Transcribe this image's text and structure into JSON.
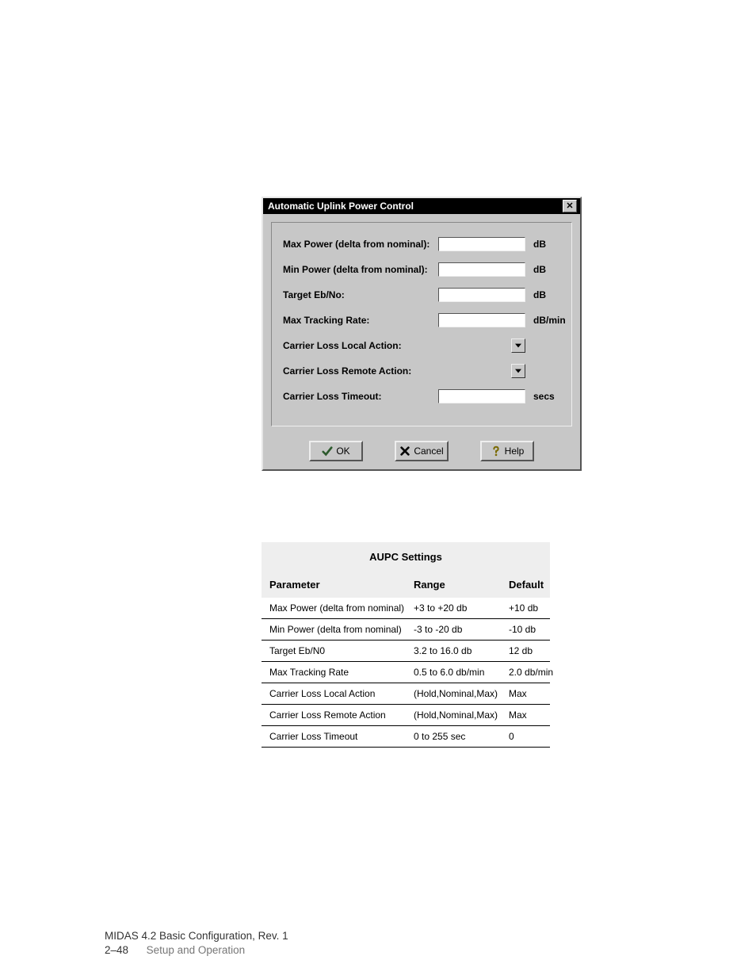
{
  "dialog": {
    "title": "Automatic Uplink Power Control",
    "close_glyph": "✕",
    "fields": [
      {
        "label": "Max Power (delta from nominal):",
        "type": "text",
        "unit": "dB"
      },
      {
        "label": "Min Power (delta from nominal):",
        "type": "text",
        "unit": "dB"
      },
      {
        "label": "Target Eb/No:",
        "type": "text",
        "unit": "dB"
      },
      {
        "label": "Max Tracking Rate:",
        "type": "text",
        "unit": "dB/min"
      },
      {
        "label": "Carrier Loss Local Action:",
        "type": "select",
        "unit": ""
      },
      {
        "label": "Carrier Loss Remote Action:",
        "type": "select",
        "unit": ""
      },
      {
        "label": "Carrier Loss Timeout:",
        "type": "text",
        "unit": "secs"
      }
    ],
    "buttons": {
      "ok": "OK",
      "cancel": "Cancel",
      "help": "Help"
    }
  },
  "table": {
    "title": "AUPC Settings",
    "headers": {
      "param": "Parameter",
      "range": "Range",
      "default": "Default"
    },
    "rows": [
      {
        "param": "Max Power (delta from nominal)",
        "range": "+3 to +20 db",
        "default": "+10 db"
      },
      {
        "param": "Min Power (delta from nominal)",
        "range": "-3 to -20 db",
        "default": "-10 db"
      },
      {
        "param": "Target Eb/N0",
        "range": "3.2 to 16.0 db",
        "default": "12 db"
      },
      {
        "param": "Max Tracking Rate",
        "range": "0.5 to 6.0 db/min",
        "default": "2.0 db/min"
      },
      {
        "param": "Carrier Loss Local Action",
        "range": "(Hold,Nominal,Max)",
        "default": "Max"
      },
      {
        "param": "Carrier Loss Remote Action",
        "range": "(Hold,Nominal,Max)",
        "default": "Max"
      },
      {
        "param": "Carrier Loss Timeout",
        "range": "0 to 255 sec",
        "default": "0"
      }
    ]
  },
  "footer": {
    "line1": "MIDAS 4.2 Basic Configuration,  Rev. 1",
    "page_no": "2–48",
    "section": "Setup and Operation"
  }
}
